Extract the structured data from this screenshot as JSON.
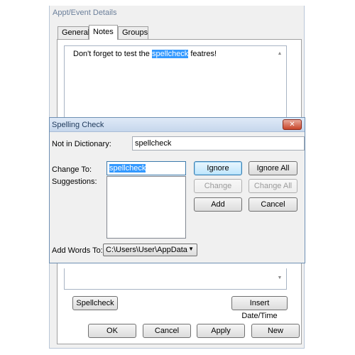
{
  "appt": {
    "title": "Appt/Event Details",
    "tabs": [
      {
        "label": "General"
      },
      {
        "label": "Notes"
      },
      {
        "label": "Groups"
      }
    ],
    "notes": {
      "before": "Don't forget to test the ",
      "highlight": "spellcheck",
      "after": " featres!"
    },
    "spellcheck_label": "Spellcheck",
    "insert_datetime_label": "Insert Date/Time",
    "footer": {
      "ok": "OK",
      "cancel": "Cancel",
      "apply": "Apply",
      "new": "New"
    }
  },
  "spell": {
    "title": "Spelling Check",
    "close_glyph": "✕",
    "not_in_dictionary_label": "Not in Dictionary:",
    "not_in_dictionary_value": "spellcheck",
    "change_to_label": "Change To:",
    "change_to_value": "spellcheck",
    "suggestions_label": "Suggestions:",
    "add_words_to_label": "Add Words To:",
    "add_words_to_value": "C:\\Users\\User\\AppData",
    "buttons": {
      "ignore": "Ignore",
      "ignore_all": "Ignore All",
      "change": "Change",
      "change_all": "Change All",
      "add": "Add",
      "cancel": "Cancel"
    }
  },
  "icons": {
    "scroll_up": "▲",
    "scroll_down": "▼",
    "combo_arrow": "▼"
  }
}
